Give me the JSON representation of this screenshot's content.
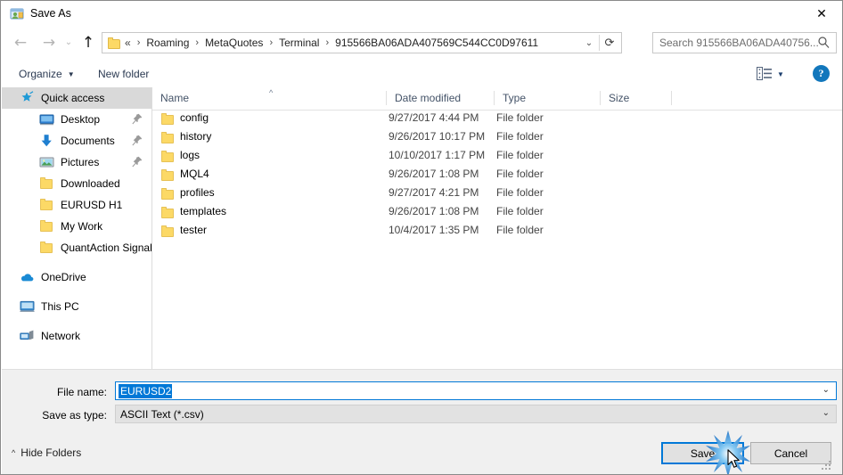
{
  "window": {
    "title": "Save As",
    "app_icon": "save-as-folder-user-icon",
    "close_label": "✕"
  },
  "navbar": {
    "back_icon": "arrow-left-icon",
    "forward_icon": "arrow-right-icon",
    "recent_icon": "chevron-down-icon",
    "up_icon": "arrow-up-icon",
    "refresh_icon": "refresh-icon",
    "dropdown_icon": "chevron-down-icon",
    "breadcrumb_prefix": "«",
    "breadcrumbs": [
      "Roaming",
      "MetaQuotes",
      "Terminal",
      "915566BA06ADA407569C544CC0D97611"
    ],
    "separator": "›",
    "search_placeholder": "Search 915566BA06ADA40756...",
    "search_icon": "search-icon"
  },
  "commandbar": {
    "organize_label": "Organize",
    "organize_caret": "▼",
    "new_folder_label": "New folder",
    "view_icon": "view-mode-icon",
    "view_caret": "▼",
    "help_label": "?",
    "help_icon": "help-icon"
  },
  "sidebar": {
    "items": [
      {
        "label": "Quick access",
        "icon": "star-pin-icon",
        "selected": true,
        "indent": false,
        "pinned": false
      },
      {
        "label": "Desktop",
        "icon": "desktop-icon",
        "selected": false,
        "indent": true,
        "pinned": true
      },
      {
        "label": "Documents",
        "icon": "documents-download-icon",
        "selected": false,
        "indent": true,
        "pinned": true
      },
      {
        "label": "Pictures",
        "icon": "pictures-icon",
        "selected": false,
        "indent": true,
        "pinned": true
      },
      {
        "label": "Downloaded",
        "icon": "folder-icon",
        "selected": false,
        "indent": true,
        "pinned": false
      },
      {
        "label": "EURUSD H1",
        "icon": "folder-icon",
        "selected": false,
        "indent": true,
        "pinned": false
      },
      {
        "label": "My Work",
        "icon": "folder-icon",
        "selected": false,
        "indent": true,
        "pinned": false
      },
      {
        "label": "QuantAction Signal",
        "icon": "folder-icon",
        "selected": false,
        "indent": true,
        "pinned": false
      }
    ],
    "groups": [
      {
        "label": "OneDrive",
        "icon": "onedrive-cloud-icon"
      },
      {
        "label": "This PC",
        "icon": "this-pc-icon"
      },
      {
        "label": "Network",
        "icon": "network-icon"
      }
    ]
  },
  "filelist": {
    "columns": [
      "Name",
      "Date modified",
      "Type",
      "Size"
    ],
    "sort_column": "Name",
    "sort_indicator": "^",
    "rows": [
      {
        "name": "config",
        "date": "9/27/2017 4:44 PM",
        "type": "File folder",
        "size": "",
        "icon": "folder-icon"
      },
      {
        "name": "history",
        "date": "9/26/2017 10:17 PM",
        "type": "File folder",
        "size": "",
        "icon": "folder-icon"
      },
      {
        "name": "logs",
        "date": "10/10/2017 1:17 PM",
        "type": "File folder",
        "size": "",
        "icon": "folder-icon"
      },
      {
        "name": "MQL4",
        "date": "9/26/2017 1:08 PM",
        "type": "File folder",
        "size": "",
        "icon": "folder-icon"
      },
      {
        "name": "profiles",
        "date": "9/27/2017 4:21 PM",
        "type": "File folder",
        "size": "",
        "icon": "folder-icon"
      },
      {
        "name": "templates",
        "date": "9/26/2017 1:08 PM",
        "type": "File folder",
        "size": "",
        "icon": "folder-icon"
      },
      {
        "name": "tester",
        "date": "10/4/2017 1:35 PM",
        "type": "File folder",
        "size": "",
        "icon": "folder-icon"
      }
    ]
  },
  "form": {
    "filename_label": "File name:",
    "filename_value": "EURUSD2",
    "filename_selected": true,
    "savetype_label": "Save as type:",
    "savetype_value": "ASCII Text (*.csv)",
    "dropdown_icon": "chevron-down-icon"
  },
  "footer": {
    "hide_folders_label": "Hide Folders",
    "hide_folders_caret": "^",
    "save_label": "Save",
    "cancel_label": "Cancel",
    "save_focused": true,
    "resize_grip": "resize-grip-icon",
    "click_effect": "click-starburst",
    "cursor": "arrow-cursor"
  },
  "colors": {
    "accent": "#0078d7",
    "selection": "#d9d9d9",
    "chrome": "#f0f0f0",
    "folder": "#fcd966",
    "help_blue": "#1277bc"
  }
}
